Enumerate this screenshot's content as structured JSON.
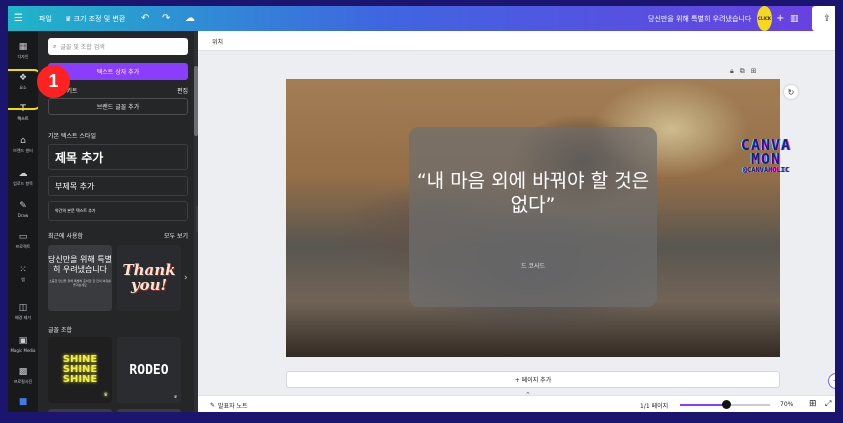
{
  "topbar": {
    "file_label": "파일",
    "resize_label": "♛ 크기 조정 및 변환",
    "promo_text": "당신만을 위해 특별히 우려냈습니다",
    "avatar_text": "CLICK"
  },
  "rail": {
    "items": [
      {
        "label": "디자인",
        "icon": "design-icon"
      },
      {
        "label": "요소",
        "icon": "elements-icon"
      },
      {
        "label": "텍스트",
        "icon": "text-icon"
      },
      {
        "label": "브랜드 센터",
        "icon": "brand-icon"
      },
      {
        "label": "업로드 항목",
        "icon": "upload-icon"
      },
      {
        "label": "Draw",
        "icon": "draw-icon"
      },
      {
        "label": "프로젝트",
        "icon": "projects-icon"
      },
      {
        "label": "앱",
        "icon": "apps-icon"
      },
      {
        "label": "배경 제거",
        "icon": "bg-remover-icon"
      },
      {
        "label": "Magic Media",
        "icon": "magic-media-icon"
      },
      {
        "label": "프로필사진",
        "icon": "profile-photo-icon"
      }
    ],
    "badge_number": "1"
  },
  "panel": {
    "search_placeholder": "글꼴 및 조합 검색",
    "add_textbox_label": "텍스트 상자 추가",
    "brand_kit_label": "브랜드 키트",
    "edit_label": "편집",
    "brand_fonts_button": "브랜드 글꼴 추가",
    "default_styles_label": "기본 텍스트 스타일",
    "heading_label": "제목 추가",
    "subheading_label": "부제목 추가",
    "body_label": "약간의 본문 텍스트 추가",
    "recent_label": "최근에 사용함",
    "see_all_label": "모두 보기",
    "recent_card_1_title": "당신만을 위해 특별히 우려냈습니다",
    "recent_card_1_sub": "소중한 당신을 위해 특별히 준비한 한 잔의 여유를 즐겨보세요",
    "recent_card_2_title": "Thank you!",
    "combos_label": "글꼴 조합",
    "combo_1_text": [
      "SHINE",
      "SHINE",
      "SHINE"
    ],
    "combo_2_text": "RODEO"
  },
  "editor": {
    "position_label": "위치",
    "quote_text": "“내 마음 외에 바꿔야 할 것은 없다”",
    "quote_author": "드 코사드",
    "sticker_line1": "CANVA",
    "sticker_line2": "MON",
    "sticker_line3": "@CANVAHOLIC",
    "add_page_label": "+ 페이지 추가"
  },
  "bottombar": {
    "notes_label": "발표자 노트",
    "pages_label": "1/1 페이지",
    "zoom_label": "70%",
    "zoom_percent": 70
  }
}
